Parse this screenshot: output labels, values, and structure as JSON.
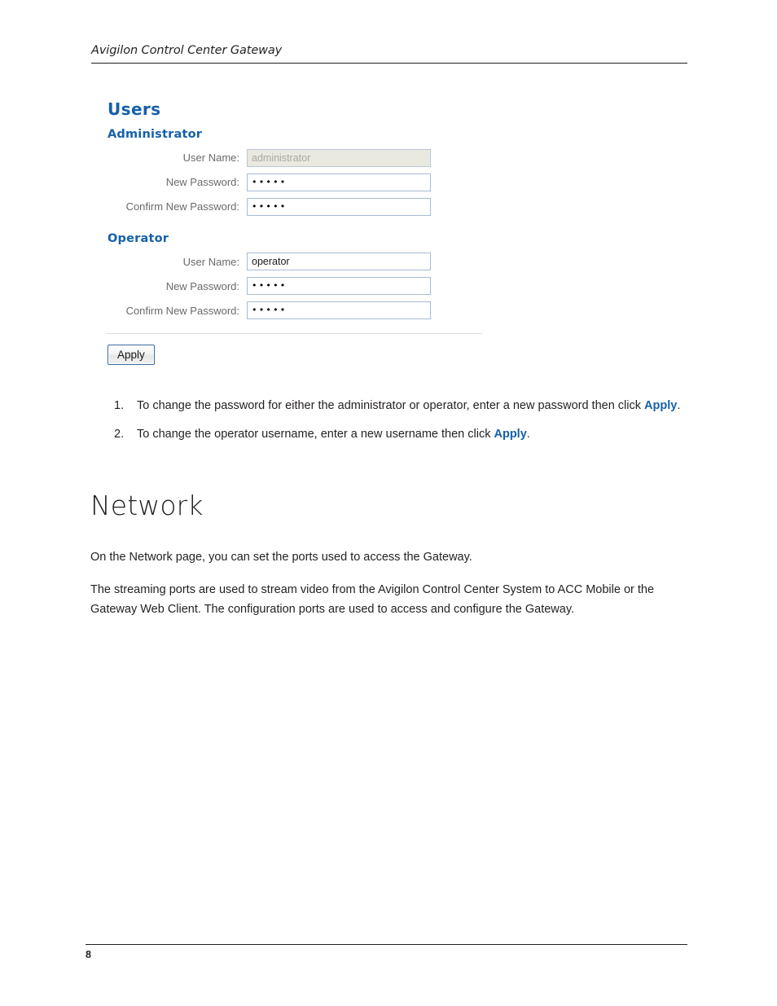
{
  "header": {
    "title": "Avigilon Control Center Gateway"
  },
  "users_panel": {
    "heading": "Users",
    "sections": [
      {
        "name": "administrator",
        "heading": "Administrator",
        "fields": [
          {
            "label": "User Name:",
            "value": "administrator",
            "type": "text",
            "disabled": true
          },
          {
            "label": "New Password:",
            "value": "•••••",
            "type": "password",
            "disabled": false
          },
          {
            "label": "Confirm New Password:",
            "value": "•••••",
            "type": "password",
            "disabled": false
          }
        ]
      },
      {
        "name": "operator",
        "heading": "Operator",
        "fields": [
          {
            "label": "User Name:",
            "value": "operator",
            "type": "text",
            "disabled": false
          },
          {
            "label": "New Password:",
            "value": "•••••",
            "type": "password",
            "disabled": false
          },
          {
            "label": "Confirm New Password:",
            "value": "•••••",
            "type": "password",
            "disabled": false
          }
        ]
      }
    ],
    "apply_label": "Apply",
    "accent_color": "#1560ab"
  },
  "instructions": [
    {
      "marker": "1.",
      "text_before": "To change the password for either the administrator or operator, enter a new password then click ",
      "keyword": "Apply",
      "text_after": "."
    },
    {
      "marker": "2.",
      "text_before": "To change the operator username, enter a new username then click ",
      "keyword": "Apply",
      "text_after": "."
    }
  ],
  "section": {
    "title": "Network",
    "paragraphs": [
      "On the Network page, you can set the ports used to access the Gateway.",
      "The streaming ports are used to stream video from the Avigilon Control Center System to ACC Mobile or the Gateway Web Client. The configuration ports are used to access and configure the Gateway."
    ]
  },
  "footer": {
    "page_number": "8"
  }
}
